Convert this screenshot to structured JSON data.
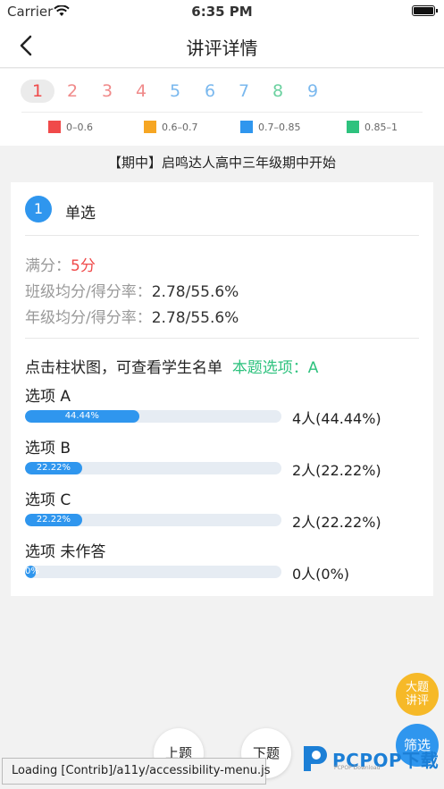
{
  "status_bar": {
    "carrier": "Carrier",
    "time": "6:35 PM"
  },
  "nav": {
    "title": "讲评详情",
    "back_icon": "chevron-left-icon"
  },
  "question_nav": {
    "numbers": [
      {
        "label": "1",
        "color": "#f04a4a",
        "active": true
      },
      {
        "label": "2",
        "color": "#f08a8a"
      },
      {
        "label": "3",
        "color": "#f08a8a"
      },
      {
        "label": "4",
        "color": "#f08a8a"
      },
      {
        "label": "5",
        "color": "#7ab8ee"
      },
      {
        "label": "6",
        "color": "#7ab8ee"
      },
      {
        "label": "7",
        "color": "#7ab8ee"
      },
      {
        "label": "8",
        "color": "#6cd1a0"
      },
      {
        "label": "9",
        "color": "#7ab8ee"
      }
    ],
    "legend": [
      {
        "label": "0–0.6",
        "color": "#f04a4a"
      },
      {
        "label": "0.6–0.7",
        "color": "#f6a623"
      },
      {
        "label": "0.7–0.85",
        "color": "#2f96ee"
      },
      {
        "label": "0.85–1",
        "color": "#2ec27e"
      }
    ]
  },
  "exam_title": "【期中】启鸣达人高中三年级期中开始",
  "question": {
    "number": "1",
    "type": "单选",
    "full_score_label": "满分：",
    "full_score_value": "5",
    "full_score_unit": "分",
    "class_avg_label": "班级均分/得分率：",
    "class_avg_value": "2.78/55.6%",
    "grade_avg_label": "年级均分/得分率：",
    "grade_avg_value": "2.78/55.6%",
    "hint": "点击柱状图，可查看学生名单",
    "answer_label": "本题选项：A"
  },
  "options": [
    {
      "label": "选项 A",
      "bar_text": "44.44%",
      "fraction": 0.4444,
      "count": "4人(44.44%)"
    },
    {
      "label": "选项 B",
      "bar_text": "22.22%",
      "fraction": 0.2222,
      "count": "2人(22.22%)"
    },
    {
      "label": "选项 C",
      "bar_text": "22.22%",
      "fraction": 0.2222,
      "count": "2人(22.22%)"
    },
    {
      "label": "选项 未作答",
      "bar_text": "0%",
      "fraction": 0,
      "count": "0人(0%)"
    }
  ],
  "buttons": {
    "prev": "上题",
    "next": "下题",
    "big_review_line1": "大题",
    "big_review_line2": "讲评",
    "filter": "筛选"
  },
  "watermark": {
    "text": "PCPOP下载",
    "sub": "PCPOP Download"
  },
  "toast": "Loading [Contrib]/a11y/accessibility-menu.js"
}
